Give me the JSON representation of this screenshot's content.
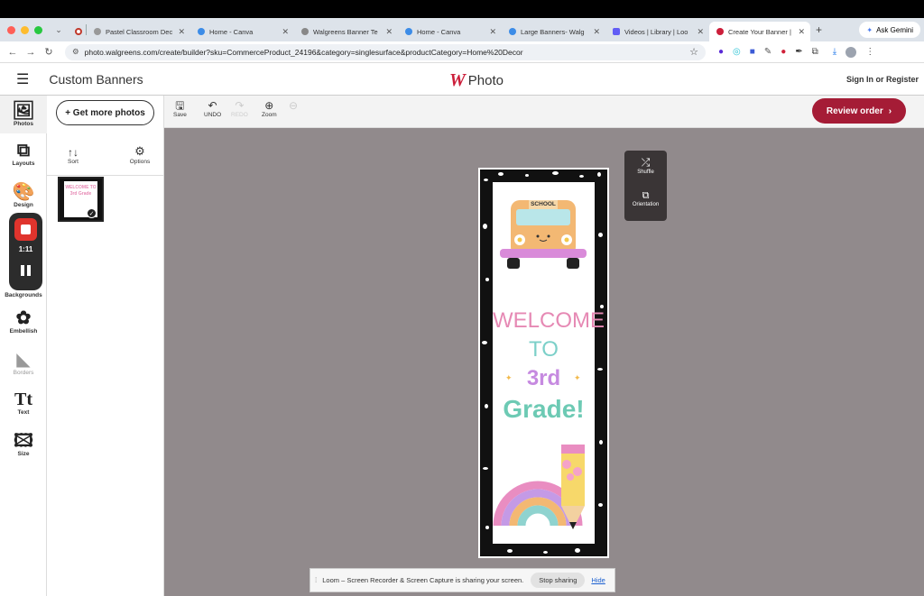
{
  "browser": {
    "tabs": [
      {
        "label": "Pastel Classroom Dec",
        "icon_color": "#c0392b"
      },
      {
        "label": "Home - Canva",
        "icon_color": "#3c8ce7"
      },
      {
        "label": "Walgreens Banner Te",
        "icon_color": "#888888"
      },
      {
        "label": "Home - Canva",
        "icon_color": "#3c8ce7"
      },
      {
        "label": "Large Banners- Walg",
        "icon_color": "#3c8ce7"
      },
      {
        "label": "Videos | Library | Loo",
        "icon_color": "#625df5"
      },
      {
        "label": "Create Your Banner |",
        "icon_color": "#cc1e3a"
      }
    ],
    "ask_gemini": "Ask Gemini",
    "url": "photo.walgreens.com/create/builder?sku=CommerceProduct_24196&category=singlesurface&productCategory=Home%20Decor"
  },
  "header": {
    "title": "Custom Banners",
    "logo_letter": "W",
    "logo_text": "Photo",
    "signin": "Sign In or Register"
  },
  "leftbar": {
    "items": [
      {
        "label": "Photos"
      },
      {
        "label": "Layouts"
      },
      {
        "label": "Design"
      },
      {
        "label": "Backgrounds"
      },
      {
        "label": "Embellish"
      },
      {
        "label": "Borders"
      },
      {
        "label": "Text"
      },
      {
        "label": "Size"
      }
    ],
    "text_icon": "Tt"
  },
  "panel": {
    "get_more": "+ Get more photos",
    "sort": "Sort",
    "options": "Options",
    "thumb_text": "WELCOME TO 3rd Grade"
  },
  "toolbar": {
    "save": "Save",
    "undo": "UNDO",
    "redo": "REDO",
    "zoom": "Zoom",
    "review": "Review order"
  },
  "floating": {
    "shuffle": "Shuffle",
    "orientation": "Orientation"
  },
  "recorder": {
    "time": "1:11"
  },
  "banner": {
    "bus_label": "SCHOOL",
    "line1": "WELCOME",
    "line2": "TO",
    "line3": "3rd",
    "line4": "Grade!"
  },
  "loom": {
    "message": "Loom – Screen Recorder & Screen Capture is sharing your screen.",
    "stop": "Stop sharing",
    "hide": "Hide"
  },
  "colors": {
    "brand_red": "#cc1e3a",
    "review_btn": "#a51c36",
    "canvas_bg": "#918a8c"
  }
}
